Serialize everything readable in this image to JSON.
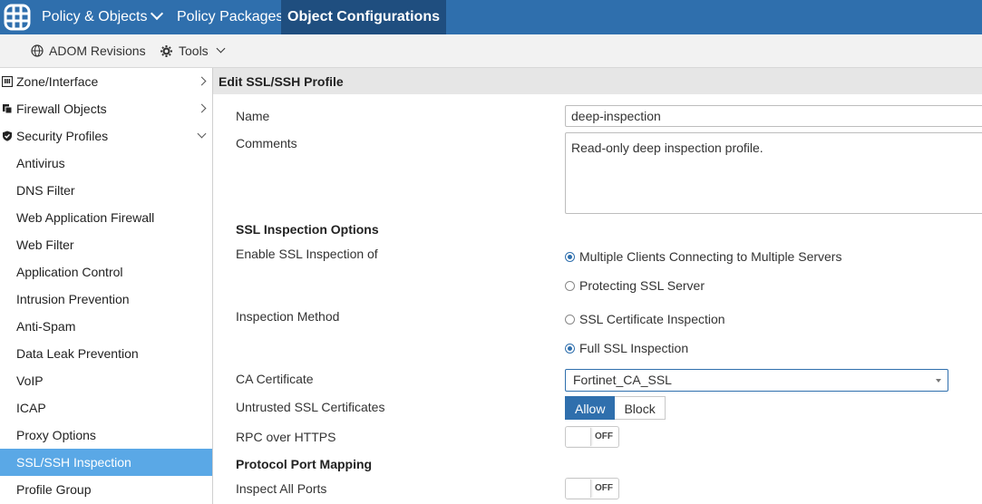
{
  "topbar": {
    "items": [
      {
        "label": "Policy & Objects"
      },
      {
        "label": "Policy Packages"
      },
      {
        "label": "Object Configurations"
      }
    ]
  },
  "subbar": {
    "adom_revisions": "ADOM Revisions",
    "tools": "Tools"
  },
  "sidebar": {
    "items": [
      {
        "label": "Zone/Interface"
      },
      {
        "label": "Firewall Objects"
      },
      {
        "label": "Security Profiles"
      },
      {
        "label": "Antivirus"
      },
      {
        "label": "DNS Filter"
      },
      {
        "label": "Web Application Firewall"
      },
      {
        "label": "Web Filter"
      },
      {
        "label": "Application Control"
      },
      {
        "label": "Intrusion Prevention"
      },
      {
        "label": "Anti-Spam"
      },
      {
        "label": "Data Leak Prevention"
      },
      {
        "label": "VoIP"
      },
      {
        "label": "ICAP"
      },
      {
        "label": "Proxy Options"
      },
      {
        "label": "SSL/SSH Inspection"
      },
      {
        "label": "Profile Group"
      }
    ]
  },
  "form": {
    "header": "Edit SSL/SSH Profile",
    "name_label": "Name",
    "name_value": "deep-inspection",
    "comments_label": "Comments",
    "comments_value": "Read-only deep inspection profile.",
    "ssl_options_title": "SSL Inspection Options",
    "enable_ssl_label": "Enable SSL Inspection of",
    "enable_ssl_opt1": "Multiple Clients Connecting to Multiple Servers",
    "enable_ssl_opt2": "Protecting SSL Server",
    "method_label": "Inspection Method",
    "method_opt1": "SSL Certificate Inspection",
    "method_opt2": "Full SSL Inspection",
    "ca_label": "CA Certificate",
    "ca_value": "Fortinet_CA_SSL",
    "untrusted_label": "Untrusted SSL Certificates",
    "allow": "Allow",
    "block": "Block",
    "rpc_label": "RPC over HTTPS",
    "rpc_state": "OFF",
    "port_mapping_title": "Protocol Port Mapping",
    "inspect_ports_label": "Inspect All Ports",
    "inspect_ports_state": "OFF"
  },
  "colors": {
    "topbar": "#2f6fad",
    "topbar_active": "#1f4e7f",
    "selected": "#5aa8e6"
  }
}
